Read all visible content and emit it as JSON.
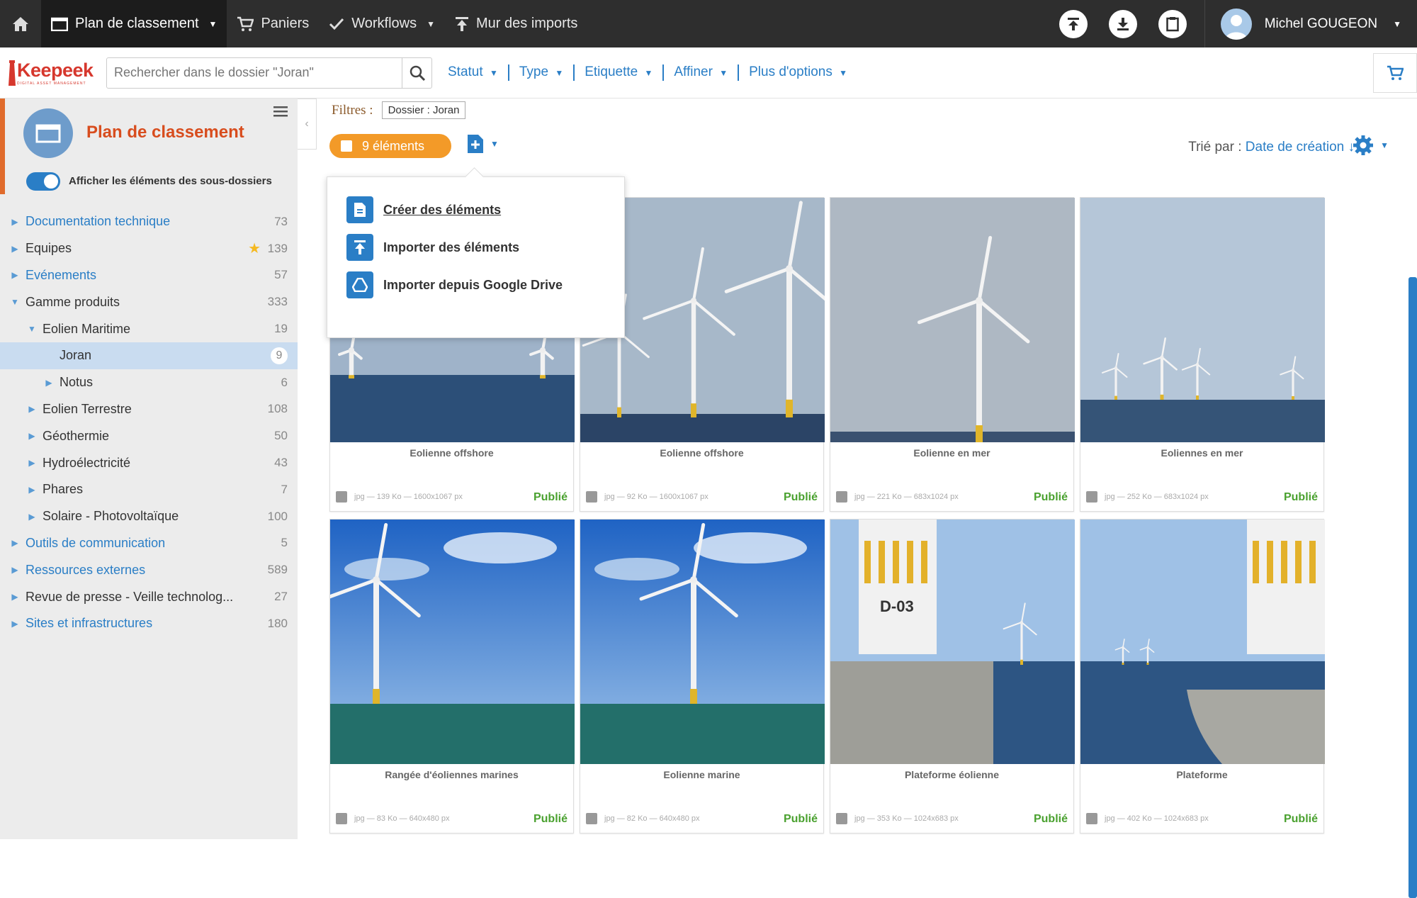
{
  "topbar": {
    "items": [
      {
        "label": "Plan de classement",
        "active": true,
        "caret": true
      },
      {
        "label": "Paniers"
      },
      {
        "label": "Workflows",
        "caret": true
      },
      {
        "label": "Mur des imports"
      }
    ],
    "user_name": "Michel GOUGEON"
  },
  "brand": {
    "logo_text": "Keepeek",
    "tagline": "DIGITAL ASSET MANAGEMENT"
  },
  "search": {
    "placeholder": "Rechercher dans le dossier \"Joran\""
  },
  "filter_menu": [
    "Statut",
    "Type",
    "Etiquette",
    "Affiner",
    "Plus d'options"
  ],
  "sidebar": {
    "title": "Plan de classement",
    "toggle_label": "Afficher les éléments des sous-dossiers",
    "tree": [
      {
        "label": "Documentation technique",
        "count": "73",
        "level": 0,
        "blue": true,
        "arrow": "right"
      },
      {
        "label": "Equipes",
        "count": "139",
        "level": 0,
        "star": true,
        "arrow": "right"
      },
      {
        "label": "Evénements",
        "count": "57",
        "level": 0,
        "blue": true,
        "arrow": "right"
      },
      {
        "label": "Gamme produits",
        "count": "333",
        "level": 0,
        "arrow": "down"
      },
      {
        "label": "Eolien Maritime",
        "count": "19",
        "level": 1,
        "arrow": "down"
      },
      {
        "label": "Joran",
        "count": "9",
        "level": 2,
        "selected": true,
        "arrow": ""
      },
      {
        "label": "Notus",
        "count": "6",
        "level": 2,
        "arrow": "right"
      },
      {
        "label": "Eolien Terrestre",
        "count": "108",
        "level": 1,
        "arrow": "right"
      },
      {
        "label": "Géothermie",
        "count": "50",
        "level": 1,
        "arrow": "right"
      },
      {
        "label": "Hydroélectricité",
        "count": "43",
        "level": 1,
        "arrow": "right"
      },
      {
        "label": "Phares",
        "count": "7",
        "level": 1,
        "arrow": "right"
      },
      {
        "label": "Solaire - Photovoltaïque",
        "count": "100",
        "level": 1,
        "arrow": "right"
      },
      {
        "label": "Outils de communication",
        "count": "5",
        "level": 0,
        "blue": true,
        "arrow": "right"
      },
      {
        "label": "Ressources externes",
        "count": "589",
        "level": 0,
        "blue": true,
        "arrow": "right"
      },
      {
        "label": "Revue de presse - Veille technolog...",
        "count": "27",
        "level": 0,
        "arrow": "right"
      },
      {
        "label": "Sites et infrastructures",
        "count": "180",
        "level": 0,
        "blue": true,
        "arrow": "right"
      }
    ]
  },
  "main": {
    "filters_label": "Filtres :",
    "filter_chip": "Dossier : Joran",
    "count_label": "9 éléments",
    "sort_prefix": "Trié par :",
    "sort_value": "Date de création ↓"
  },
  "add_menu": [
    {
      "label": "Créer des éléments",
      "icon": "file-icon",
      "underline": true
    },
    {
      "label": "Importer des éléments",
      "icon": "upload-icon"
    },
    {
      "label": "Importer depuis Google Drive",
      "icon": "google-drive-icon"
    }
  ],
  "cards": [
    {
      "title": "Eolienne offshore",
      "meta": "jpg — 139 Ko — 1600x1067 px",
      "status": "Publié",
      "scene": "sea-small"
    },
    {
      "title": "Eolienne offshore",
      "meta": "jpg — 92 Ko — 1600x1067 px",
      "status": "Publié",
      "scene": "sea-group"
    },
    {
      "title": "Eolienne en mer",
      "meta": "jpg — 221 Ko — 683x1024 px",
      "status": "Publié",
      "scene": "sea-single"
    },
    {
      "title": "Eoliennes en mer",
      "meta": "jpg — 252 Ko — 683x1024 px",
      "status": "Publié",
      "scene": "sea-far"
    },
    {
      "title": "Rangée d'éoliennes marines",
      "meta": "jpg — 83 Ko — 640x480 px",
      "status": "Publié",
      "scene": "blue-sky"
    },
    {
      "title": "Eolienne marine",
      "meta": "jpg — 82 Ko — 640x480 px",
      "status": "Publié",
      "scene": "blue-sky2"
    },
    {
      "title": "Plateforme éolienne",
      "meta": "jpg — 353 Ko — 1024x683 px",
      "status": "Publié",
      "scene": "platform",
      "tower_label": "D-03"
    },
    {
      "title": "Plateforme",
      "meta": "jpg — 402 Ko — 1024x683 px",
      "status": "Publié",
      "scene": "platform2"
    }
  ],
  "colors": {
    "accent": "#2a7ec6",
    "orange": "#f39a28",
    "published": "#4aa12f",
    "brand_red": "#d6372d"
  }
}
